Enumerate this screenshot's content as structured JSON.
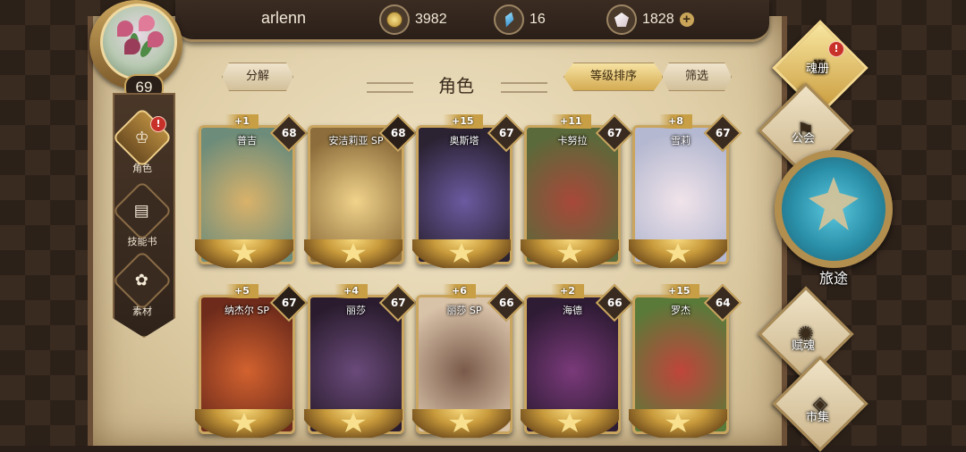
{
  "player": {
    "name": "arlenn",
    "level": "69",
    "gold": "3982",
    "crystals": "16",
    "gems": "1828",
    "add_label": "+"
  },
  "left_nav": [
    {
      "label": "角色",
      "icon": "helmet-icon",
      "alert": "!"
    },
    {
      "label": "技能书",
      "icon": "book-icon"
    },
    {
      "label": "素材",
      "icon": "material-icon"
    }
  ],
  "header": {
    "disassemble": "分解",
    "title": "角色",
    "sort": "等级排序",
    "filter": "筛选"
  },
  "heroes": [
    {
      "name": "普吉",
      "level": "68",
      "bonus": "+1",
      "colors": [
        "#d9b26a",
        "#6d8c7a"
      ]
    },
    {
      "name": "安洁莉亚 SP",
      "level": "68",
      "bonus": "",
      "colors": [
        "#f1d38b",
        "#8c6d3b"
      ]
    },
    {
      "name": "奥斯塔",
      "level": "67",
      "bonus": "+15",
      "colors": [
        "#6b5aa0",
        "#2b2232"
      ]
    },
    {
      "name": "卡努拉",
      "level": "67",
      "bonus": "+11",
      "colors": [
        "#a8483a",
        "#5a6a3a"
      ]
    },
    {
      "name": "雪莉",
      "level": "67",
      "bonus": "+8",
      "colors": [
        "#f1e4ea",
        "#b4b8d0"
      ]
    },
    {
      "name": "纳杰尔 SP",
      "level": "67",
      "bonus": "+5",
      "colors": [
        "#d3622f",
        "#6e2b1b"
      ]
    },
    {
      "name": "丽莎",
      "level": "67",
      "bonus": "+4",
      "colors": [
        "#6a4a7a",
        "#2a1c2e"
      ]
    },
    {
      "name": "丽莎 SP",
      "level": "66",
      "bonus": "+6",
      "colors": [
        "#7a5a4a",
        "#d8c2a8"
      ]
    },
    {
      "name": "海德",
      "level": "66",
      "bonus": "+2",
      "colors": [
        "#7a3a7a",
        "#2e1b34"
      ]
    },
    {
      "name": "罗杰",
      "level": "64",
      "bonus": "+15",
      "colors": [
        "#c0453a",
        "#5a7a3a"
      ]
    }
  ],
  "right_nav": [
    {
      "label": "魂册",
      "icon": "soul-book-icon",
      "alert": "!"
    },
    {
      "label": "公会",
      "icon": "guild-icon"
    },
    {
      "label": "旅途",
      "icon": "journey-emblem-icon"
    },
    {
      "label": "赋魂",
      "icon": "flame-icon"
    },
    {
      "label": "市集",
      "icon": "market-icon"
    }
  ]
}
